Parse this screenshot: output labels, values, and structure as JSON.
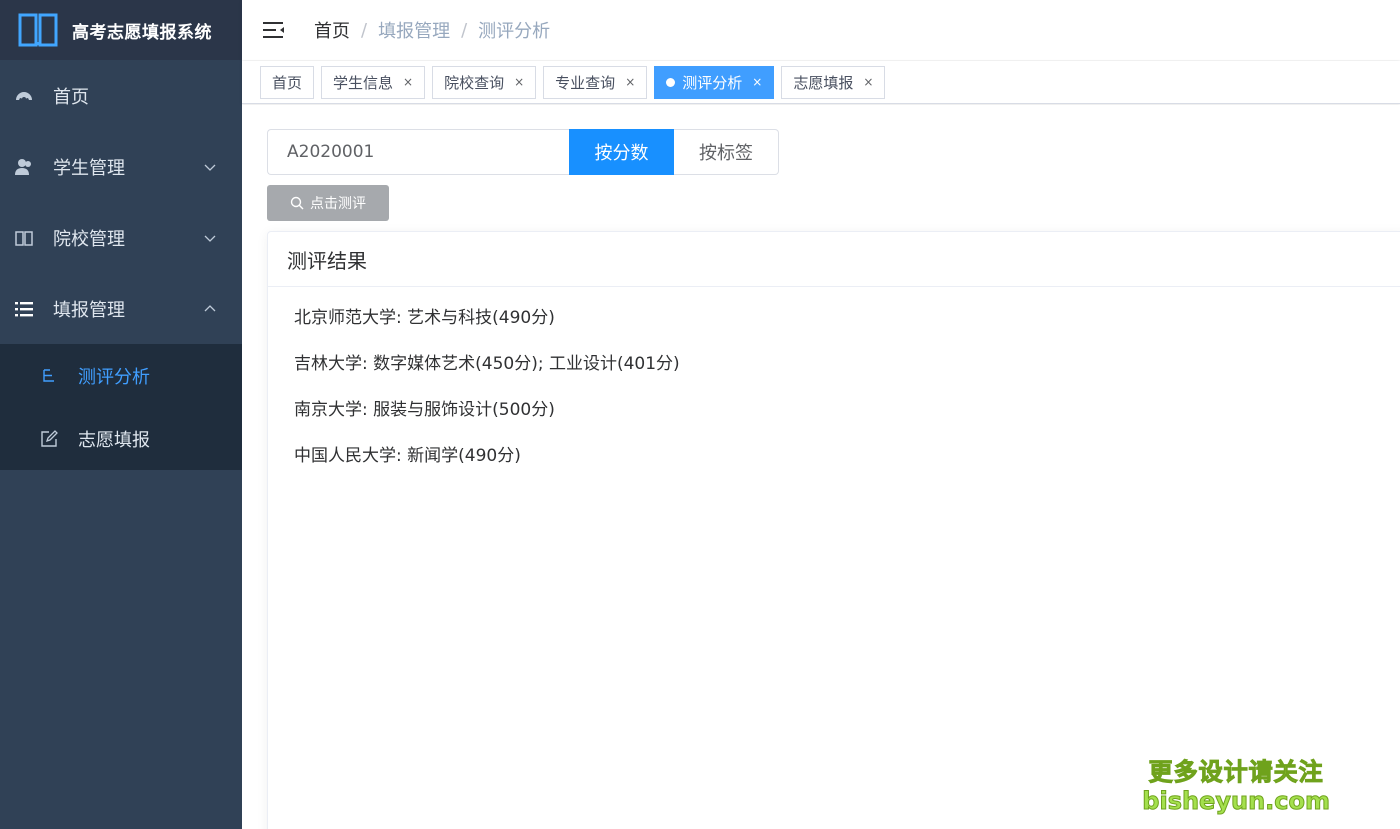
{
  "app": {
    "title": "高考志愿填报系统"
  },
  "sidebar": {
    "items": [
      {
        "label": "首页",
        "icon": "dashboard-icon"
      },
      {
        "label": "学生管理",
        "icon": "user-icon"
      },
      {
        "label": "院校管理",
        "icon": "book-icon"
      },
      {
        "label": "填报管理",
        "icon": "list-icon"
      }
    ],
    "sub_items": [
      {
        "label": "测评分析",
        "icon": "tree-icon",
        "active": true
      },
      {
        "label": "志愿填报",
        "icon": "edit-icon"
      }
    ]
  },
  "breadcrumb": {
    "home": "首页",
    "sep": "/",
    "level1": "填报管理",
    "level2": "测评分析"
  },
  "tags": [
    {
      "label": "首页"
    },
    {
      "label": "学生信息",
      "close": "×"
    },
    {
      "label": "院校查询",
      "close": "×"
    },
    {
      "label": "专业查询",
      "close": "×"
    },
    {
      "label": "测评分析",
      "close": "×",
      "active": true
    },
    {
      "label": "志愿填报",
      "close": "×"
    }
  ],
  "search": {
    "value": "A2020001",
    "score_button": "按分数",
    "tag_button": "按标签",
    "eval_button": "点击测评"
  },
  "result_card": {
    "title": "测评结果",
    "lines": [
      "北京师范大学: 艺术与科技(490分)",
      "吉林大学: 数字媒体艺术(450分); 工业设计(401分)",
      "南京大学: 服装与服饰设计(500分)",
      "中国人民大学: 新闻学(490分)"
    ]
  },
  "watermark": {
    "line1": "更多设计请关注",
    "line2": "bisheyun.com"
  },
  "colors": {
    "sidebar_bg": "#304156",
    "accent": "#1890ff",
    "active_text": "#409eff"
  }
}
